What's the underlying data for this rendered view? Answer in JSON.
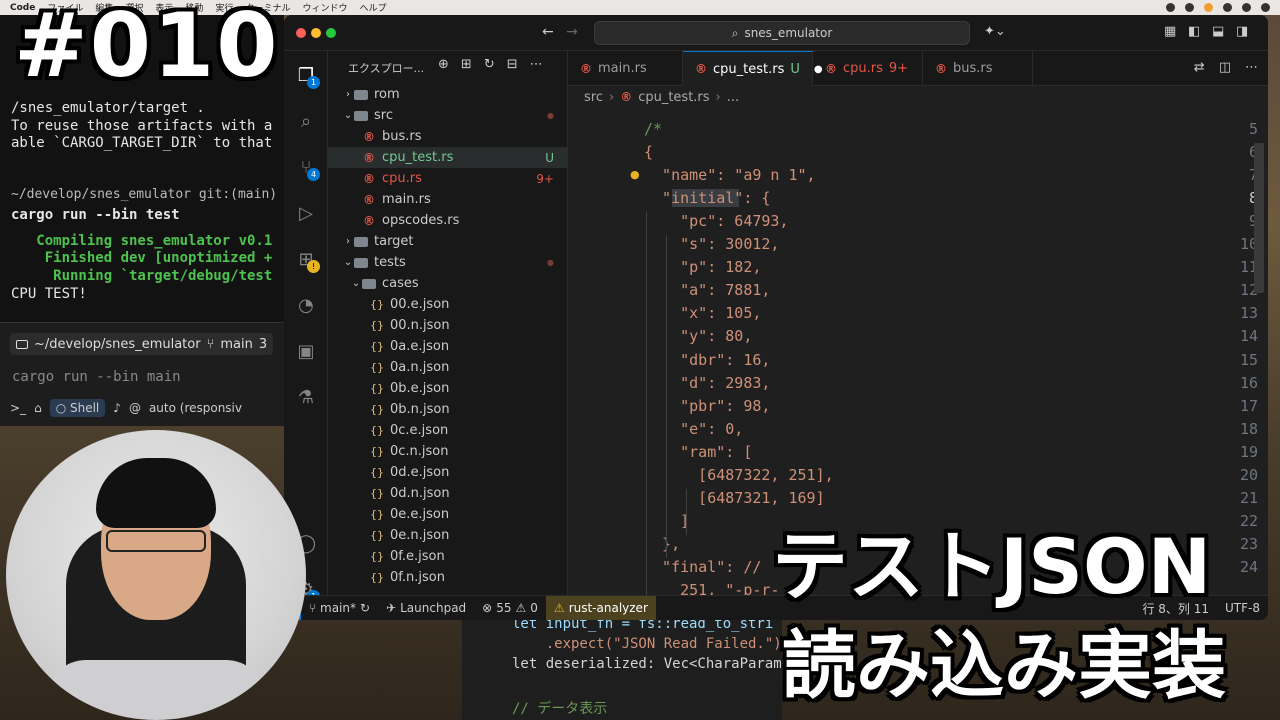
{
  "menubar": {
    "app": "Code",
    "items": [
      "ファイル",
      "編集",
      "選択",
      "表示",
      "移動",
      "実行",
      "ターミナル",
      "ウィンドウ",
      "ヘルプ"
    ]
  },
  "overlay": {
    "episode": "#010",
    "title_line1": "テストJSON",
    "title_line2": "読み込み実装"
  },
  "terminal": {
    "lines": [
      "/snes_emulator/target .",
      "To reuse those artifacts with a",
      "able `CARGO_TARGET_DIR` to that"
    ],
    "prompt_path": "~/develop/snes_emulator git:(main)",
    "command": "cargo run --bin test",
    "out1": "   Compiling snes_emulator v0.1",
    "out2": "    Finished dev [unoptimized +",
    "out3": "     Running `target/debug/test",
    "out4": "CPU TEST!",
    "bar_path": "~/develop/snes_emulator",
    "bar_branch": "main",
    "bar_count": "3",
    "input_text": "cargo run --bin main",
    "shell_label": "Shell",
    "mode_label": "auto (responsiv"
  },
  "vscode": {
    "search": "snes_emulator",
    "explorer_title": "エクスプロー...",
    "tree": [
      {
        "label": "rom",
        "kind": "folder",
        "chev": "›",
        "indent": 0,
        "status": "",
        "dot": false
      },
      {
        "label": "src",
        "kind": "folder-open",
        "chev": "⌄",
        "indent": 0,
        "status": "",
        "dot": true
      },
      {
        "label": "bus.rs",
        "kind": "rust",
        "chev": "",
        "indent": 1,
        "status": "",
        "dot": false
      },
      {
        "label": "cpu_test.rs",
        "kind": "rust",
        "chev": "",
        "indent": 1,
        "status": "U",
        "dot": false
      },
      {
        "label": "cpu.rs",
        "kind": "rust",
        "chev": "",
        "indent": 1,
        "status": "9+",
        "dot": false
      },
      {
        "label": "main.rs",
        "kind": "rust",
        "chev": "",
        "indent": 1,
        "status": "",
        "dot": false
      },
      {
        "label": "opscodes.rs",
        "kind": "rust",
        "chev": "",
        "indent": 1,
        "status": "",
        "dot": false
      },
      {
        "label": "target",
        "kind": "folder",
        "chev": "›",
        "indent": 0,
        "status": "",
        "dot": false
      },
      {
        "label": "tests",
        "kind": "folder-open",
        "chev": "⌄",
        "indent": 0,
        "status": "",
        "dot": true
      },
      {
        "label": "cases",
        "kind": "folder-open",
        "chev": "⌄",
        "indent": 1,
        "status": "",
        "dot": false
      },
      {
        "label": "00.e.json",
        "kind": "json",
        "chev": "",
        "indent": 2,
        "status": "",
        "dot": false
      },
      {
        "label": "00.n.json",
        "kind": "json",
        "chev": "",
        "indent": 2,
        "status": "",
        "dot": false
      },
      {
        "label": "0a.e.json",
        "kind": "json",
        "chev": "",
        "indent": 2,
        "status": "",
        "dot": false
      },
      {
        "label": "0a.n.json",
        "kind": "json",
        "chev": "",
        "indent": 2,
        "status": "",
        "dot": false
      },
      {
        "label": "0b.e.json",
        "kind": "json",
        "chev": "",
        "indent": 2,
        "status": "",
        "dot": false
      },
      {
        "label": "0b.n.json",
        "kind": "json",
        "chev": "",
        "indent": 2,
        "status": "",
        "dot": false
      },
      {
        "label": "0c.e.json",
        "kind": "json",
        "chev": "",
        "indent": 2,
        "status": "",
        "dot": false
      },
      {
        "label": "0c.n.json",
        "kind": "json",
        "chev": "",
        "indent": 2,
        "status": "",
        "dot": false
      },
      {
        "label": "0d.e.json",
        "kind": "json",
        "chev": "",
        "indent": 2,
        "status": "",
        "dot": false
      },
      {
        "label": "0d.n.json",
        "kind": "json",
        "chev": "",
        "indent": 2,
        "status": "",
        "dot": false
      },
      {
        "label": "0e.e.json",
        "kind": "json",
        "chev": "",
        "indent": 2,
        "status": "",
        "dot": false
      },
      {
        "label": "0e.n.json",
        "kind": "json",
        "chev": "",
        "indent": 2,
        "status": "",
        "dot": false
      },
      {
        "label": "0f.e.json",
        "kind": "json",
        "chev": "",
        "indent": 2,
        "status": "",
        "dot": false
      },
      {
        "label": "0f.n.json",
        "kind": "json",
        "chev": "",
        "indent": 2,
        "status": "",
        "dot": false
      }
    ],
    "tabs": [
      {
        "label": "main.rs",
        "active": false,
        "suffix": ""
      },
      {
        "label": "cpu_test.rs",
        "active": true,
        "suffix": "U"
      },
      {
        "label": "cpu.rs",
        "active": false,
        "suffix": "9+"
      },
      {
        "label": "bus.rs",
        "active": false,
        "suffix": ""
      }
    ],
    "breadcrumb": {
      "folder": "src",
      "file": "cpu_test.rs",
      "more": "..."
    },
    "lines": [
      {
        "n": "5",
        "t": "/*"
      },
      {
        "n": "6",
        "t": "{"
      },
      {
        "n": "7",
        "t": "  \"name\": \"a9 n 1\","
      },
      {
        "n": "8",
        "t": "  \"initial\": {"
      },
      {
        "n": "9",
        "t": "    \"pc\": 64793,"
      },
      {
        "n": "10",
        "t": "    \"s\": 30012,"
      },
      {
        "n": "11",
        "t": "    \"p\": 182,"
      },
      {
        "n": "12",
        "t": "    \"a\": 7881,"
      },
      {
        "n": "13",
        "t": "    \"x\": 105,"
      },
      {
        "n": "14",
        "t": "    \"y\": 80,"
      },
      {
        "n": "15",
        "t": "    \"dbr\": 16,"
      },
      {
        "n": "16",
        "t": "    \"d\": 2983,"
      },
      {
        "n": "17",
        "t": "    \"pbr\": 98,"
      },
      {
        "n": "18",
        "t": "    \"e\": 0,"
      },
      {
        "n": "19",
        "t": "    \"ram\": ["
      },
      {
        "n": "20",
        "t": "      [6487322, 251],"
      },
      {
        "n": "21",
        "t": "      [6487321, 169]"
      },
      {
        "n": "22",
        "t": "    ]"
      },
      {
        "n": "23",
        "t": "  },"
      },
      {
        "n": "24",
        "t": "  \"final\": //"
      },
      {
        "n": "",
        "t": "    251, \"-p-r-"
      }
    ],
    "status": {
      "branch": "main*",
      "launchpad": "Launchpad",
      "errors": "55",
      "warnings": "0",
      "rust": "rust-analyzer",
      "pos": "行 8、列 11",
      "encoding": "UTF-8"
    },
    "badges": {
      "explorer": "1",
      "scm": "4",
      "accounts": "1"
    }
  },
  "code2": {
    "l1": "let input_fn = fs::read_to_stri",
    "l2": "    .expect(\"JSON Read Failed.\")",
    "l3": "let deserialized: Vec<CharaParam",
    "l4": "// データ表示"
  },
  "colors": {
    "accent": "#0078d4",
    "rust": "#e45649",
    "json": "#e5c07b",
    "string": "#ce9178",
    "key": "#9cdcfe",
    "number": "#b5cea8",
    "warning": "#e6b422"
  }
}
